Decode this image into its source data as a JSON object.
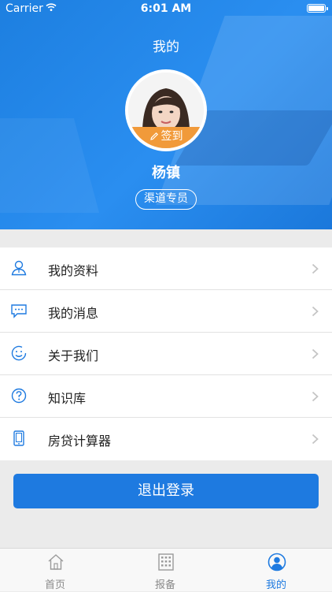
{
  "status_bar": {
    "carrier": "Carrier",
    "time": "6:01 AM"
  },
  "header": {
    "title": "我的",
    "signin_label": "签到",
    "username": "杨镇",
    "role": "渠道专员"
  },
  "menu": [
    {
      "label": "我的资料",
      "icon": "user-profile-icon"
    },
    {
      "label": "我的消息",
      "icon": "message-icon"
    },
    {
      "label": "关于我们",
      "icon": "smile-icon"
    },
    {
      "label": "知识库",
      "icon": "question-icon"
    },
    {
      "label": "房贷计算器",
      "icon": "phone-calculator-icon"
    }
  ],
  "logout_label": "退出登录",
  "tabs": [
    {
      "label": "首页",
      "icon": "home-icon",
      "active": false
    },
    {
      "label": "报备",
      "icon": "building-icon",
      "active": false
    },
    {
      "label": "我的",
      "icon": "profile-icon",
      "active": true
    }
  ],
  "colors": {
    "primary": "#1e7ae0",
    "signin": "#f19a3a",
    "tab_inactive": "#8a8a8a"
  }
}
